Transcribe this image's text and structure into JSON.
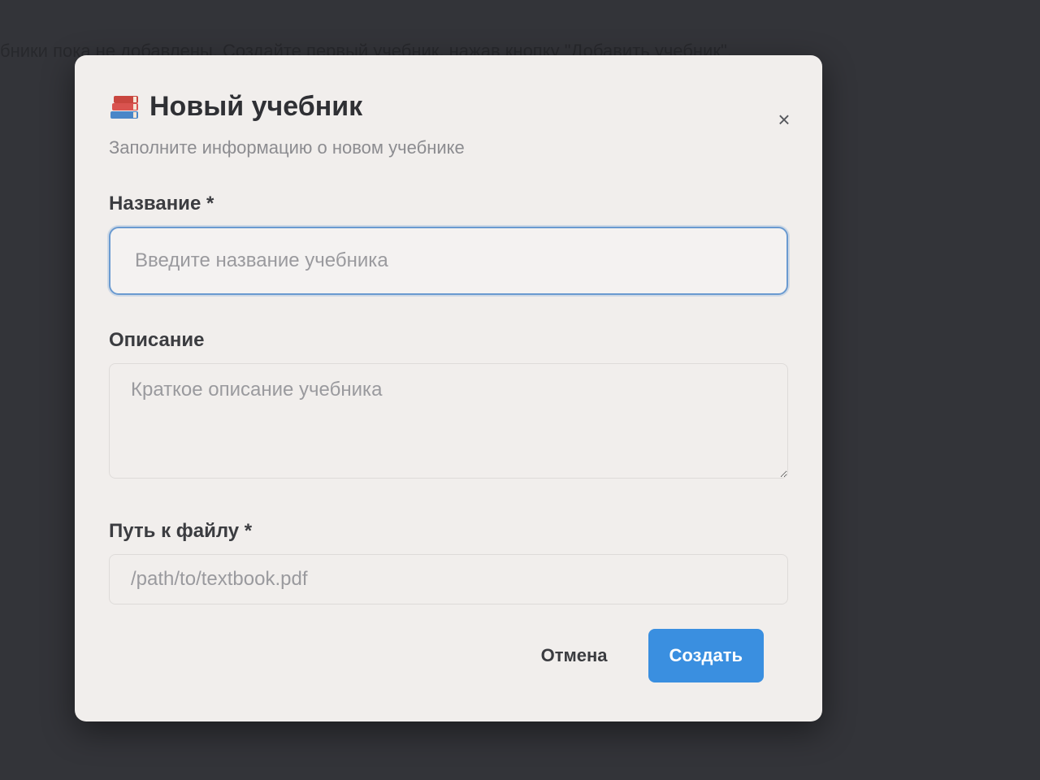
{
  "background": {
    "text": "бники пока не добавлены. Создайте первый учебник, нажав кнопку \"Добавить учебник\"."
  },
  "dialog": {
    "title": "Новый учебник",
    "title_icon": "books-icon",
    "subtitle": "Заполните информацию о новом учебнике",
    "close_label": "×",
    "fields": {
      "name": {
        "label": "Название",
        "required_mark": "*",
        "placeholder": "Введите название учебника",
        "value": ""
      },
      "description": {
        "label": "Описание",
        "placeholder": "Краткое описание учебника",
        "value": ""
      },
      "file_path": {
        "label": "Путь к файлу",
        "required_mark": "*",
        "placeholder": "/path/to/textbook.pdf",
        "value": ""
      }
    },
    "buttons": {
      "cancel": "Отмена",
      "create": "Создать"
    }
  },
  "colors": {
    "accent": "#3a8fe0",
    "focus_border": "#6a9ad0",
    "dialog_bg": "#f1eeec",
    "backdrop": "#3a3b40"
  }
}
